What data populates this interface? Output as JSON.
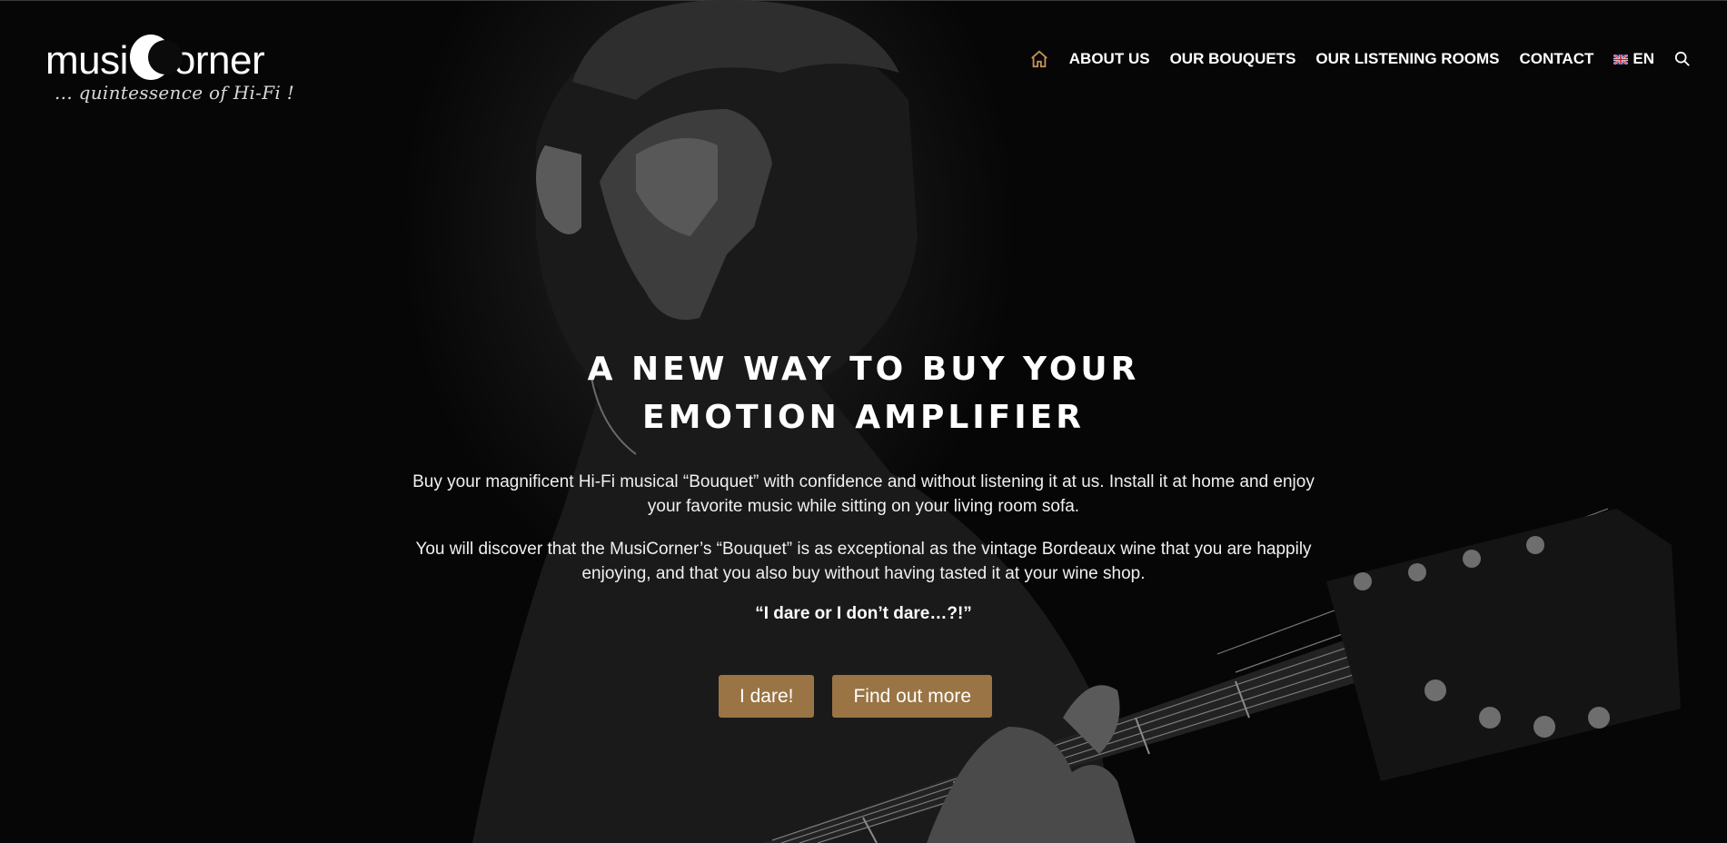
{
  "brand": {
    "logo_wordmark_left": "musi",
    "logo_wordmark_right": "orner",
    "tagline": "... quintessence of Hi-Fi !"
  },
  "nav": {
    "home_icon": "home-icon",
    "items": [
      {
        "label": "ABOUT US"
      },
      {
        "label": "OUR BOUQUETS"
      },
      {
        "label": "OUR LISTENING ROOMS"
      },
      {
        "label": "CONTACT"
      }
    ],
    "language": {
      "flag_icon": "uk-flag-icon",
      "label": "EN"
    },
    "search_icon": "search-icon"
  },
  "hero": {
    "title_line1": "A NEW WAY TO BUY YOUR",
    "title_line2": "EMOTION AMPLIFIER",
    "paragraph1": "Buy your magnificent Hi-Fi musical “Bouquet” with confidence and without listening it at us. Install it at home and enjoy your favorite music while sitting on your living room sofa.",
    "paragraph2": "You will discover that the MusiCorner’s “Bouquet” is as exceptional as the vintage Bordeaux wine that you are happily enjoying, and that you also buy without having tasted it at your wine shop.",
    "quote": "“I dare or I don’t dare…?!”",
    "buttons": [
      {
        "label": "I dare!"
      },
      {
        "label": "Find out more"
      }
    ]
  },
  "colors": {
    "accent": "#9a7444",
    "home_icon": "#c8925a",
    "background": "#000000",
    "text": "#ffffff"
  }
}
